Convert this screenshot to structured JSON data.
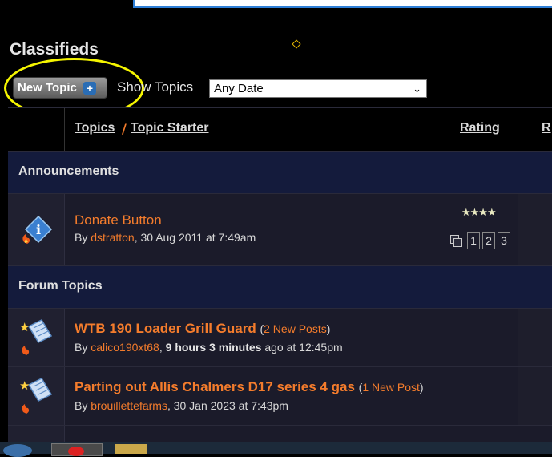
{
  "page": {
    "title": "Classifieds"
  },
  "toolbar": {
    "new_topic_label": "New Topic",
    "show_topics_label": "Show Topics",
    "date_filter_value": "Any Date"
  },
  "table": {
    "headers": {
      "topics": "Topics",
      "separator": "/",
      "topic_starter": "Topic Starter",
      "rating": "Rating",
      "replies_partial": "R"
    },
    "sections": [
      {
        "label": "Announcements"
      },
      {
        "label": "Forum Topics"
      }
    ],
    "announcement": {
      "title": "Donate Button",
      "by_prefix": "By",
      "author": "dstratton",
      "date": ", 30 Aug 2011 at 7:49am",
      "rating_stars": 4,
      "rating_glyphs": "★★★★",
      "pages": [
        "1",
        "2",
        "3"
      ]
    },
    "topics": [
      {
        "title": "WTB 190 Loader Grill Guard",
        "new_posts": "2 New Posts",
        "by_prefix": "By",
        "author": "calico190xt68",
        "time_bold": "9 hours 3 minutes",
        "time_rest": " ago at 12:45pm"
      },
      {
        "title": "Parting out Allis Chalmers D17 series 4 gas",
        "new_posts": "1 New Post",
        "by_prefix": "By",
        "author": "brouillettefarms",
        "date": ", 30 Jan 2023 at 7:43pm"
      }
    ]
  },
  "colors": {
    "accent": "#f47c2c",
    "section_bg": "#141b3c",
    "row_bg": "#1b1b2a",
    "highlight_ring": "#f5f500"
  },
  "icons": [
    "plus-icon",
    "announcement-icon",
    "topic-icon",
    "hot-flame-icon",
    "multi-page-icon",
    "chevron-down-icon"
  ]
}
